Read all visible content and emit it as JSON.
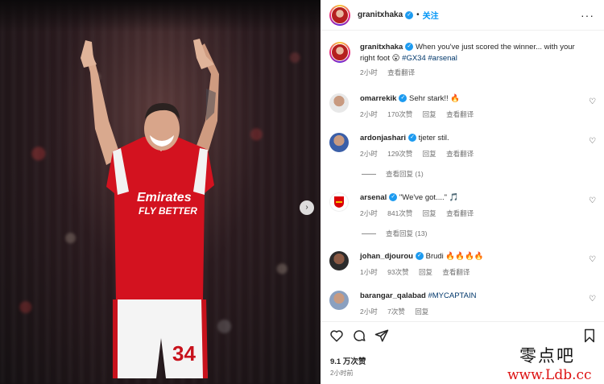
{
  "post": {
    "author": "granitxhaka",
    "follow_label": "关注",
    "separator": "•",
    "more_label": "···",
    "next_label": "›"
  },
  "caption": {
    "username": "granitxhaka",
    "text": " When you've just scored the winner... with your right foot 😮 ",
    "tags": "#GX34 #arsenal",
    "time": "2小时",
    "translate": "查看翻译"
  },
  "comments": [
    {
      "username": "omarrekik",
      "verified": true,
      "text": " Sehr stark!! 🔥",
      "time": "2小时",
      "likes": "170次赞",
      "reply": "回复",
      "translate": "查看翻译",
      "view_replies": ""
    },
    {
      "username": "ardonjashari",
      "verified": true,
      "text": " tjeter stil.",
      "time": "2小时",
      "likes": "129次赞",
      "reply": "回复",
      "translate": "查看翻译",
      "view_replies": "查看回复 (1)"
    },
    {
      "username": "arsenal",
      "verified": true,
      "text": " \"We've got....\" 🎵",
      "time": "2小时",
      "likes": "841次赞",
      "reply": "回复",
      "translate": "查看翻译",
      "view_replies": "查看回复 (13)"
    },
    {
      "username": "johan_djourou",
      "verified": true,
      "text": " Brudi 🔥🔥🔥🔥",
      "time": "1小时",
      "likes": "93次赞",
      "reply": "回复",
      "translate": "查看翻译",
      "view_replies": ""
    },
    {
      "username": "barangar_qalabad",
      "verified": false,
      "text": " #MYCAPTAIN",
      "time": "2小时",
      "likes": "7次赞",
      "reply": "回复",
      "translate": "",
      "view_replies": ""
    }
  ],
  "footer": {
    "likes": "9.1 万次赞",
    "time": "2小时前"
  },
  "watermark": {
    "line1": "零点吧",
    "line2": "www.Ldb.cc"
  },
  "colors": {
    "accent": "#0095f6",
    "verified": "#1d9bf0",
    "hashtag": "#00376b",
    "secondary_text": "#737373",
    "watermark_red": "#dd1111"
  }
}
